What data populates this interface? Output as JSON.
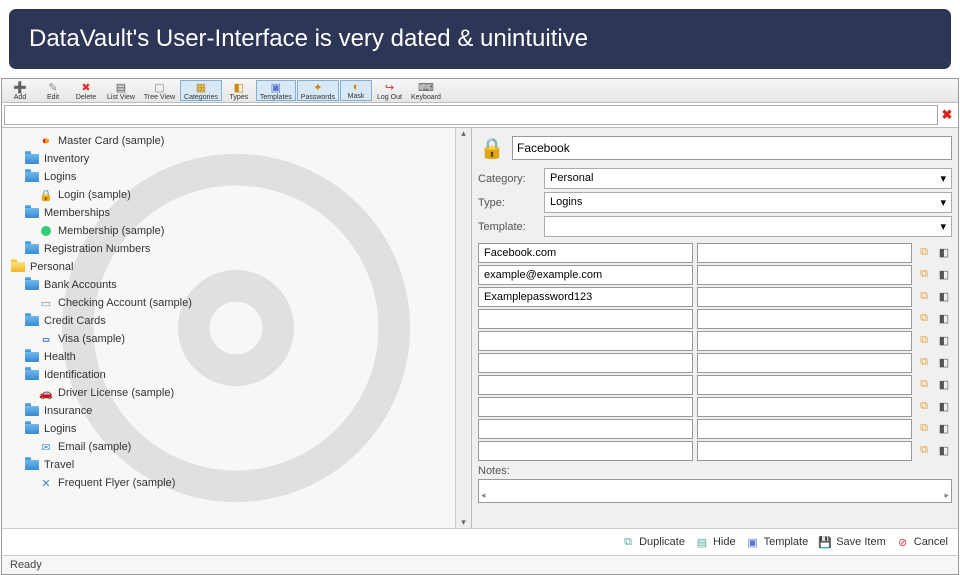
{
  "banner": "DataVault's User-Interface is very dated & unintuitive",
  "toolbar": [
    {
      "label": "Add",
      "icon": "➕",
      "color": "#3a3"
    },
    {
      "label": "Edit",
      "icon": "✎",
      "color": "#888"
    },
    {
      "label": "Delete",
      "icon": "✖",
      "color": "#d33"
    },
    {
      "label": "List View",
      "icon": "▤",
      "color": "#555"
    },
    {
      "label": "Tree View",
      "icon": "▢",
      "color": "#888"
    },
    {
      "label": "Categories",
      "icon": "▦",
      "color": "#c80",
      "pressed": true
    },
    {
      "label": "Types",
      "icon": "◧",
      "color": "#c80"
    },
    {
      "label": "Templates",
      "icon": "▣",
      "color": "#57c",
      "pressed": true
    },
    {
      "label": "Passwords",
      "icon": "✦",
      "color": "#c80",
      "pressed": true
    },
    {
      "label": "Mask",
      "icon": "◐",
      "color": "#c80",
      "pressed": true
    },
    {
      "label": "Log Out",
      "icon": "↪",
      "color": "#d33"
    },
    {
      "label": "Keyboard",
      "icon": "⌨",
      "color": "#555"
    }
  ],
  "search": {
    "value": ""
  },
  "tree": [
    {
      "label": "Master Card (sample)",
      "indent": 2,
      "icon": "mc"
    },
    {
      "label": "Inventory",
      "indent": 1,
      "icon": "folder"
    },
    {
      "label": "Logins",
      "indent": 1,
      "icon": "folder"
    },
    {
      "label": "Login (sample)",
      "indent": 2,
      "icon": "lock"
    },
    {
      "label": "Memberships",
      "indent": 1,
      "icon": "folder"
    },
    {
      "label": "Membership (sample)",
      "indent": 2,
      "icon": "member"
    },
    {
      "label": "Registration Numbers",
      "indent": 1,
      "icon": "folder"
    },
    {
      "label": "Personal",
      "indent": 0,
      "icon": "folder-y"
    },
    {
      "label": "Bank Accounts",
      "indent": 1,
      "icon": "folder"
    },
    {
      "label": "Checking Account (sample)",
      "indent": 2,
      "icon": "check"
    },
    {
      "label": "Credit Cards",
      "indent": 1,
      "icon": "folder"
    },
    {
      "label": "Visa (sample)",
      "indent": 2,
      "icon": "visa"
    },
    {
      "label": "Health",
      "indent": 1,
      "icon": "folder"
    },
    {
      "label": "Identification",
      "indent": 1,
      "icon": "folder"
    },
    {
      "label": "Driver License (sample)",
      "indent": 2,
      "icon": "car"
    },
    {
      "label": "Insurance",
      "indent": 1,
      "icon": "folder"
    },
    {
      "label": "Logins",
      "indent": 1,
      "icon": "folder"
    },
    {
      "label": "Email (sample)",
      "indent": 2,
      "icon": "mail"
    },
    {
      "label": "Travel",
      "indent": 1,
      "icon": "folder"
    },
    {
      "label": "Frequent Flyer (sample)",
      "indent": 2,
      "icon": "tool"
    }
  ],
  "details": {
    "title": "Facebook",
    "category_label": "Category:",
    "category": "Personal",
    "type_label": "Type:",
    "type": "Logins",
    "template_label": "Template:",
    "template": "",
    "fields": [
      {
        "v1": "Facebook.com",
        "v2": ""
      },
      {
        "v1": "example@example.com",
        "v2": ""
      },
      {
        "v1": "Examplepassword123",
        "v2": ""
      },
      {
        "v1": "",
        "v2": ""
      },
      {
        "v1": "",
        "v2": ""
      },
      {
        "v1": "",
        "v2": ""
      },
      {
        "v1": "",
        "v2": ""
      },
      {
        "v1": "",
        "v2": ""
      },
      {
        "v1": "",
        "v2": ""
      },
      {
        "v1": "",
        "v2": ""
      }
    ],
    "notes_label": "Notes:"
  },
  "actions": [
    {
      "label": "Duplicate",
      "icon": "⧉",
      "color": "#5a9"
    },
    {
      "label": "Hide",
      "icon": "▤",
      "color": "#5a9"
    },
    {
      "label": "Template",
      "icon": "▣",
      "color": "#57c"
    },
    {
      "label": "Save Item",
      "icon": "💾",
      "color": "#555"
    },
    {
      "label": "Cancel",
      "icon": "⊘",
      "color": "#d33"
    }
  ],
  "status": "Ready"
}
